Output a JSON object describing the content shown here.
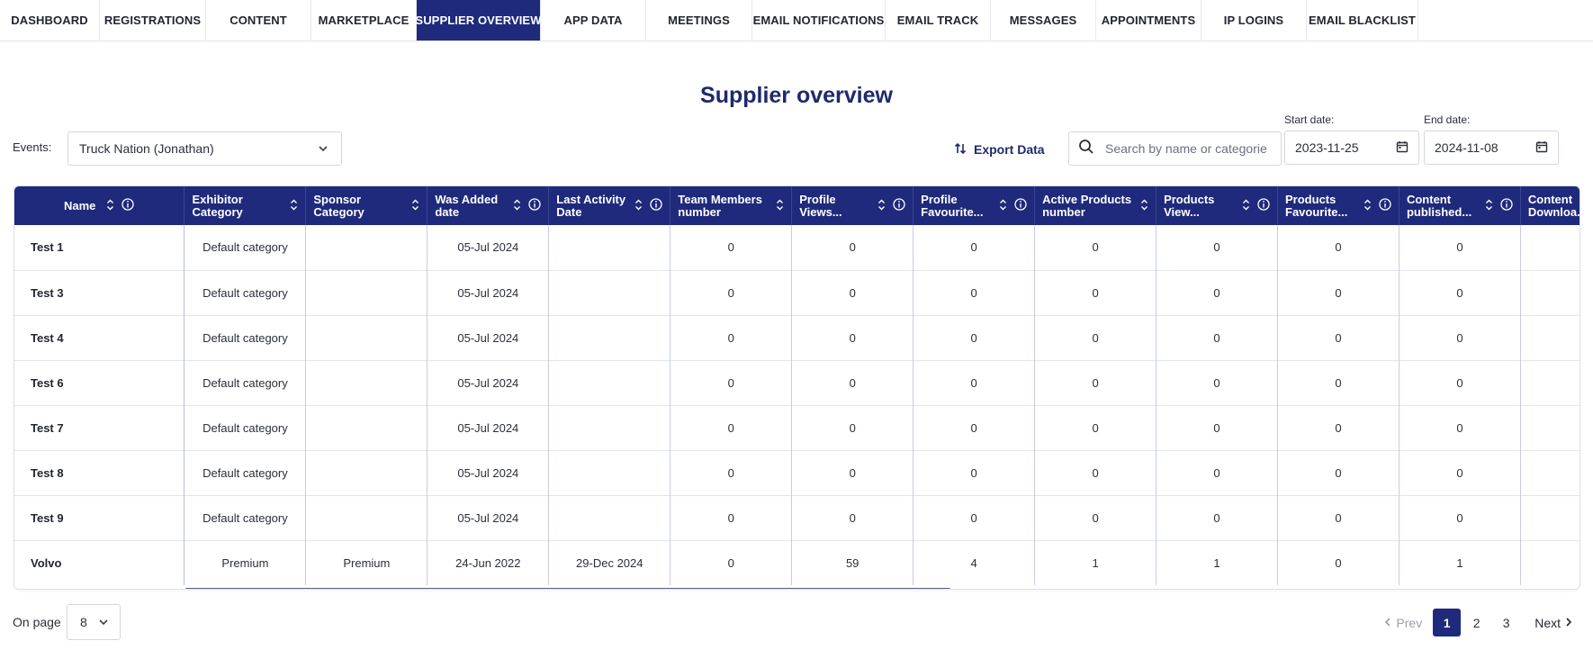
{
  "nav": {
    "tabs": [
      {
        "label": "DASHBOARD",
        "active": false
      },
      {
        "label": "REGISTRATIONS",
        "active": false
      },
      {
        "label": "CONTENT",
        "active": false
      },
      {
        "label": "MARKETPLACE",
        "active": false
      },
      {
        "label": "SUPPLIER OVERVIEW",
        "active": true
      },
      {
        "label": "APP DATA",
        "active": false
      },
      {
        "label": "MEETINGS",
        "active": false
      },
      {
        "label": "EMAIL NOTIFICATIONS",
        "active": false
      },
      {
        "label": "EMAIL TRACK",
        "active": false
      },
      {
        "label": "MESSAGES",
        "active": false
      },
      {
        "label": "APPOINTMENTS",
        "active": false
      },
      {
        "label": "IP LOGINS",
        "active": false
      },
      {
        "label": "EMAIL BLACKLIST",
        "active": false
      }
    ]
  },
  "page": {
    "title": "Supplier overview"
  },
  "filters": {
    "events_label": "Events:",
    "events_value": "Truck Nation (Jonathan)",
    "export_label": "Export Data",
    "search_placeholder": "Search by name or categorie",
    "start_label": "Start date:",
    "start_value": "2023-11-25",
    "end_label": "End date:",
    "end_value": "2024-11-08"
  },
  "table": {
    "columns": [
      {
        "label": "Name",
        "sortable": true,
        "info": true
      },
      {
        "label": "Exhibitor Category",
        "sortable": true,
        "info": false
      },
      {
        "label": "Sponsor Category",
        "sortable": true,
        "info": false
      },
      {
        "label": "Was Added date",
        "sortable": true,
        "info": true
      },
      {
        "label": "Last Activity Date",
        "sortable": true,
        "info": true
      },
      {
        "label": "Team Members number",
        "sortable": true,
        "info": false
      },
      {
        "label": "Profile Views...",
        "sortable": true,
        "info": true
      },
      {
        "label": "Profile Favourite...",
        "sortable": true,
        "info": true
      },
      {
        "label": "Active Products number",
        "sortable": true,
        "info": false
      },
      {
        "label": "Products View...",
        "sortable": true,
        "info": true
      },
      {
        "label": "Products Favourite...",
        "sortable": true,
        "info": true
      },
      {
        "label": "Content published...",
        "sortable": true,
        "info": true
      },
      {
        "label": "Content Downloa...",
        "sortable": false,
        "info": false
      }
    ],
    "rows": [
      [
        "Test 1",
        "Default category",
        "",
        "05-Jul 2024",
        "",
        "0",
        "0",
        "0",
        "0",
        "0",
        "0",
        "0",
        ""
      ],
      [
        "Test 3",
        "Default category",
        "",
        "05-Jul 2024",
        "",
        "0",
        "0",
        "0",
        "0",
        "0",
        "0",
        "0",
        ""
      ],
      [
        "Test 4",
        "Default category",
        "",
        "05-Jul 2024",
        "",
        "0",
        "0",
        "0",
        "0",
        "0",
        "0",
        "0",
        ""
      ],
      [
        "Test 6",
        "Default category",
        "",
        "05-Jul 2024",
        "",
        "0",
        "0",
        "0",
        "0",
        "0",
        "0",
        "0",
        ""
      ],
      [
        "Test 7",
        "Default category",
        "",
        "05-Jul 2024",
        "",
        "0",
        "0",
        "0",
        "0",
        "0",
        "0",
        "0",
        ""
      ],
      [
        "Test 8",
        "Default category",
        "",
        "05-Jul 2024",
        "",
        "0",
        "0",
        "0",
        "0",
        "0",
        "0",
        "0",
        ""
      ],
      [
        "Test 9",
        "Default category",
        "",
        "05-Jul 2024",
        "",
        "0",
        "0",
        "0",
        "0",
        "0",
        "0",
        "0",
        ""
      ],
      [
        "Volvo",
        "Premium",
        "Premium",
        "24-Jun 2022",
        "29-Dec 2024",
        "0",
        "59",
        "4",
        "1",
        "1",
        "0",
        "1",
        ""
      ]
    ]
  },
  "footer": {
    "on_page_label": "On page",
    "on_page_value": "8",
    "prev_label": "Prev",
    "next_label": "Next",
    "pages": [
      "1",
      "2",
      "3"
    ],
    "active_page": "1"
  },
  "colors": {
    "primary": "#1f2a7c",
    "title": "#1f2a6b"
  }
}
